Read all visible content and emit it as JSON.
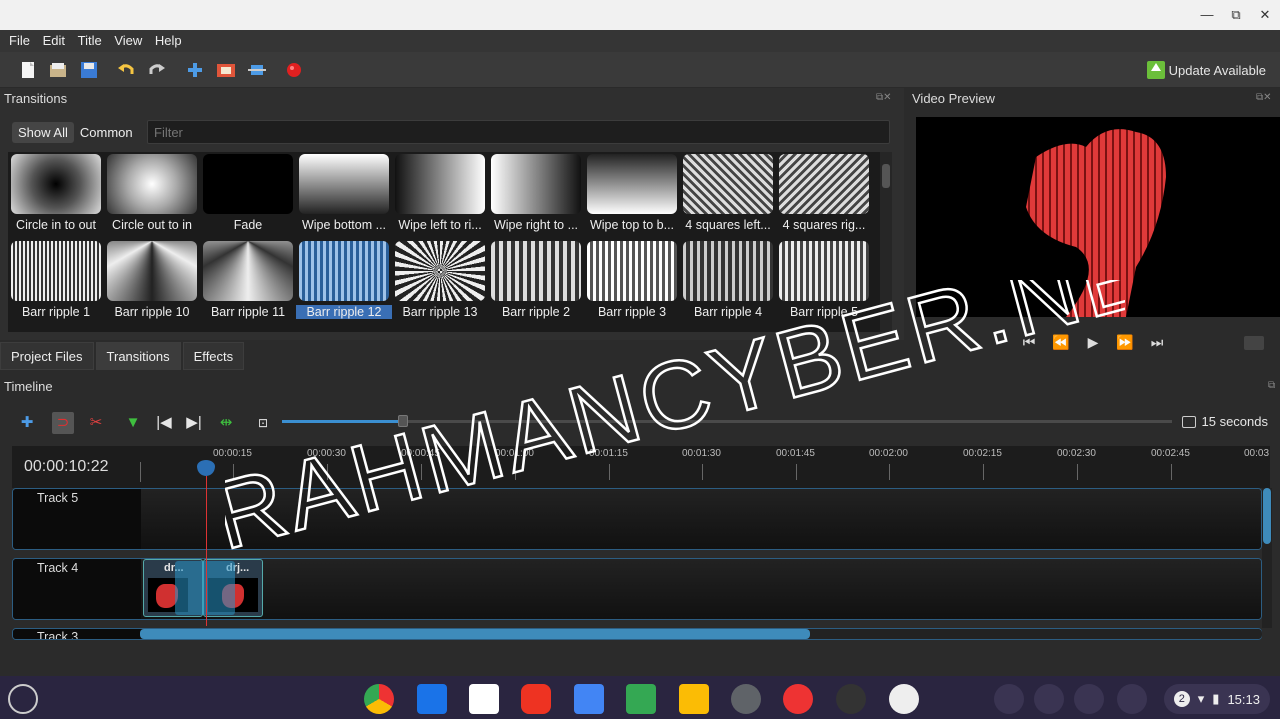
{
  "window": {
    "controls": [
      "—",
      "⧉",
      "✕"
    ]
  },
  "menu": [
    "File",
    "Edit",
    "Title",
    "View",
    "Help"
  ],
  "toolbar": {
    "update_label": "Update Available"
  },
  "transitions": {
    "title": "Transitions",
    "filters": [
      "Show All",
      "Common"
    ],
    "filter_placeholder": "Filter",
    "row1": [
      "Circle in to out",
      "Circle out to in",
      "Fade",
      "Wipe bottom ...",
      "Wipe left to ri...",
      "Wipe right to ...",
      "Wipe top to b...",
      "4 squares left...",
      "4 squares rig..."
    ],
    "row2": [
      "Barr ripple 1",
      "Barr ripple 10",
      "Barr ripple 11",
      "Barr ripple 12",
      "Barr ripple 13",
      "Barr ripple 2",
      "Barr ripple 3",
      "Barr ripple 4",
      "Barr ripple 5"
    ],
    "selected": "Barr ripple 12"
  },
  "tabs": [
    "Project Files",
    "Transitions",
    "Effects"
  ],
  "video_preview": {
    "title": "Video Preview"
  },
  "timeline": {
    "title": "Timeline",
    "zoom_label": "15 seconds",
    "zoom_fraction": 0.136,
    "timecode": "00:00:10:22",
    "ruler": [
      "00:00:15",
      "00:00:30",
      "00:00:45",
      "00:01:00",
      "00:01:15",
      "00:01:30",
      "00:01:45",
      "00:02:00",
      "00:02:15",
      "00:02:30",
      "00:02:45",
      "00:03"
    ],
    "tracks": [
      "Track 5",
      "Track 4",
      "Track 3"
    ],
    "clips": [
      "dr...",
      "drj..."
    ]
  },
  "watermark": "RAHMANCYBER.NET",
  "shelf": {
    "time": "15:13",
    "notifications": "2"
  }
}
